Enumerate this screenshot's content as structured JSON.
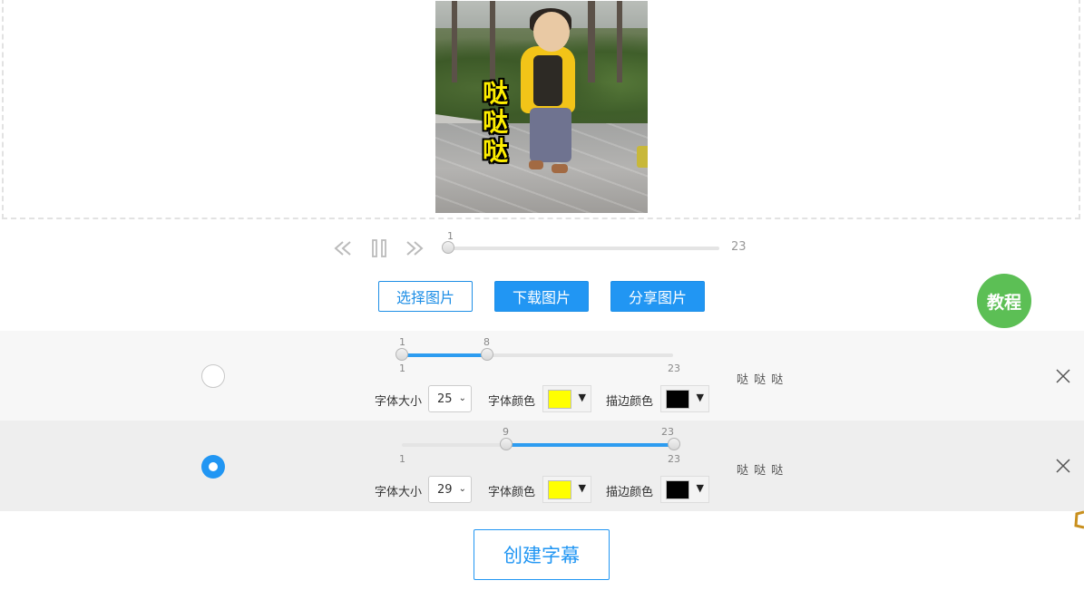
{
  "preview": {
    "caption_text": "哒哒哒",
    "caption_chars": [
      "哒",
      "哒",
      "哒"
    ]
  },
  "player": {
    "frame_min": "1",
    "frame_total": "23",
    "current_frame": 1
  },
  "actions": {
    "select_image": "选择图片",
    "download_image": "下载图片",
    "share_image": "分享图片",
    "tutorial": "教程"
  },
  "subtitles": [
    {
      "selected": false,
      "range_start": "1",
      "range_end": "8",
      "min_label": "1",
      "max_label": "23",
      "font_size_label": "字体大小",
      "font_size": "25",
      "font_color_label": "字体颜色",
      "font_color": "#ffff00",
      "stroke_color_label": "描边颜色",
      "stroke_color": "#000000",
      "text": "哒 哒 哒"
    },
    {
      "selected": true,
      "range_start": "9",
      "range_end": "23",
      "min_label": "1",
      "max_label": "23",
      "font_size_label": "字体大小",
      "font_size": "29",
      "font_color_label": "字体颜色",
      "font_color": "#ffff00",
      "stroke_color_label": "描边颜色",
      "stroke_color": "#000000",
      "text": "哒 哒 哒"
    }
  ],
  "create_subtitle": "创建字幕",
  "colors": {
    "accent": "#2196f3",
    "tutorial_bg": "#5cbf55"
  }
}
